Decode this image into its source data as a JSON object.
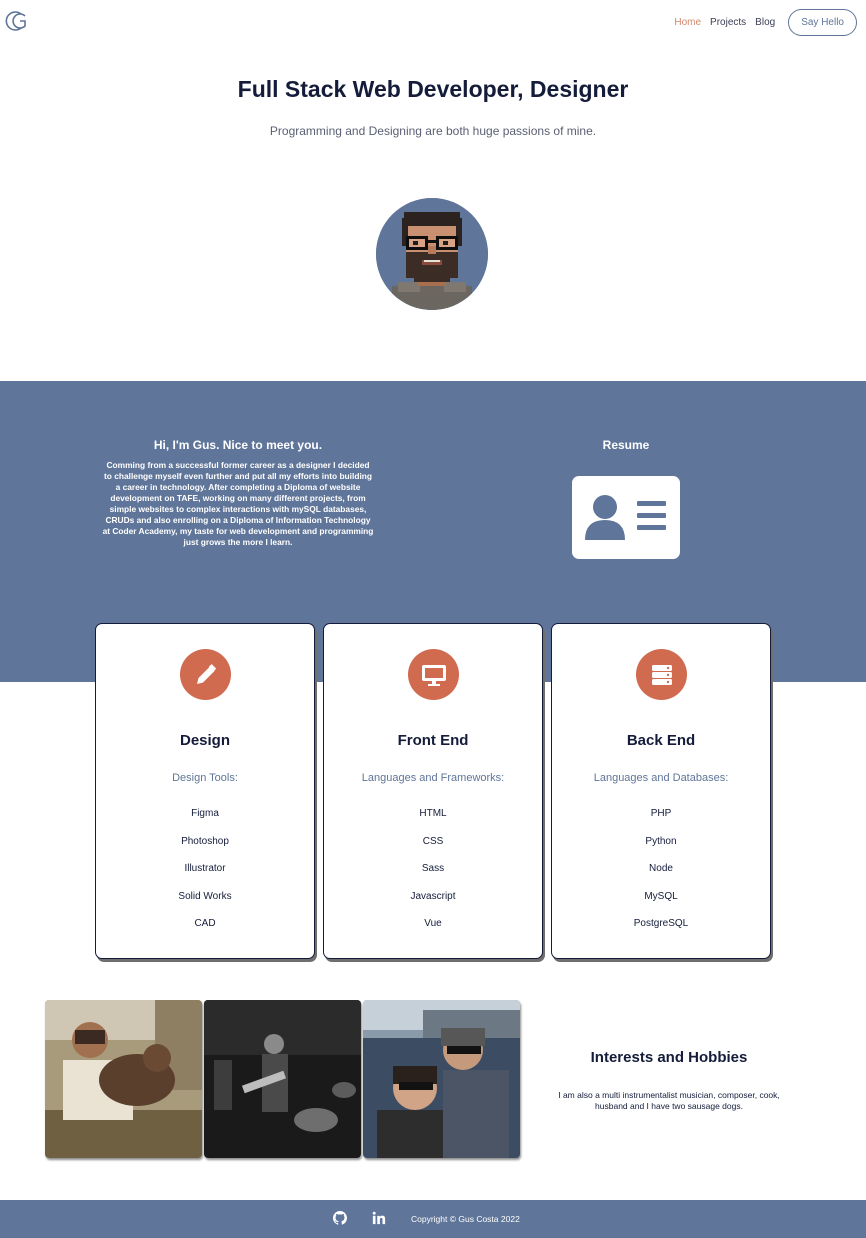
{
  "nav": {
    "logo_icon": "gc-logo-icon",
    "links": [
      "Home",
      "Projects",
      "Blog"
    ],
    "active": "Home",
    "cta": "Say Hello"
  },
  "hero": {
    "title": "Full Stack Web Developer, Designer",
    "subtitle": "Programming and Designing are both huge passions of mine.",
    "avatar_icon": "pixel-avatar"
  },
  "about": {
    "heading": "Hi, I'm Gus. Nice to meet you.",
    "text": "Comming from a successful former career as a designer I decided to challenge myself even further and put all my efforts into building a career in technology. After completing a Diploma of website development on TAFE, working on many different projects, from simple websites to complex interactions with mySQL databases, CRUDs and also enrolling on a Diploma of Information Technology at Coder Academy, my taste for web development and programming just grows the more I learn.",
    "resume_title": "Resume",
    "resume_icon": "id-card-icon"
  },
  "skills": [
    {
      "icon": "pencil-icon",
      "title": "Design",
      "subtitle": "Design Tools:",
      "items": [
        "Figma",
        "Photoshop",
        "Illustrator",
        "Solid Works",
        "CAD"
      ]
    },
    {
      "icon": "monitor-icon",
      "title": "Front End",
      "subtitle": "Languages and Frameworks:",
      "items": [
        "HTML",
        "CSS",
        "Sass",
        "Javascript",
        "Vue"
      ]
    },
    {
      "icon": "server-icon",
      "title": "Back End",
      "subtitle": "Languages and Databases:",
      "items": [
        "PHP",
        "Python",
        "Node",
        "MySQL",
        "PostgreSQL"
      ]
    }
  ],
  "hobbies": {
    "title": "Interests and Hobbies",
    "text": "I am also a multi instrumentalist musician, composer, cook, husband and I have two sausage dogs."
  },
  "footer": {
    "github_icon": "github-icon",
    "linkedin_icon": "linkedin-icon",
    "copyright": "Copyright © Gus Costa 2022"
  },
  "colors": {
    "accent": "#d16b50",
    "brand_blue": "#5f7599",
    "dark_text": "#141c3a",
    "nav_active": "#d2886a"
  }
}
